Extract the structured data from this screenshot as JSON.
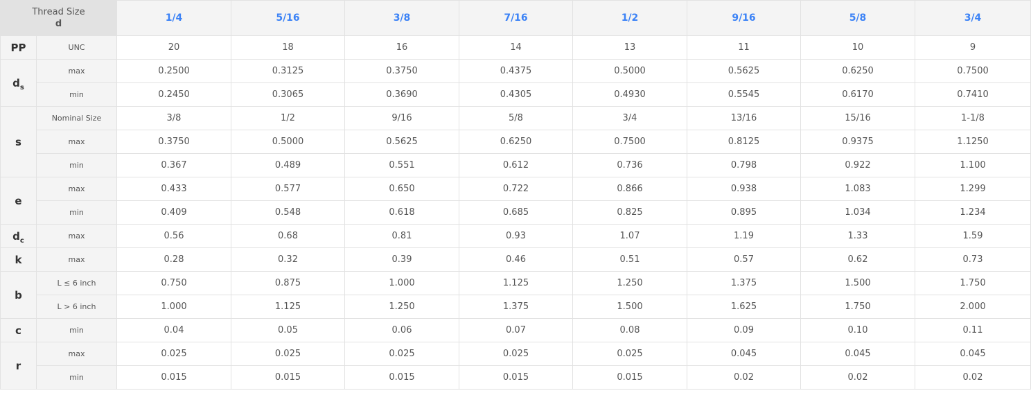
{
  "header": {
    "corner_title": "Thread Size",
    "corner_var": "d",
    "sizes": [
      "1/4",
      "5/16",
      "3/8",
      "7/16",
      "1/2",
      "9/16",
      "5/8",
      "3/4"
    ]
  },
  "params": {
    "pp": "PP",
    "ds": {
      "base": "d",
      "sub": "s"
    },
    "s": "s",
    "e": "e",
    "dc": {
      "base": "d",
      "sub": "c"
    },
    "k": "k",
    "b": "b",
    "c": "c",
    "r": "r"
  },
  "rows": [
    {
      "sub": "UNC",
      "values": [
        "20",
        "18",
        "16",
        "14",
        "13",
        "11",
        "10",
        "9"
      ]
    },
    {
      "sub": "max",
      "values": [
        "0.2500",
        "0.3125",
        "0.3750",
        "0.4375",
        "0.5000",
        "0.5625",
        "0.6250",
        "0.7500"
      ]
    },
    {
      "sub": "min",
      "values": [
        "0.2450",
        "0.3065",
        "0.3690",
        "0.4305",
        "0.4930",
        "0.5545",
        "0.6170",
        "0.7410"
      ]
    },
    {
      "sub": "Nominal Size",
      "values": [
        "3/8",
        "1/2",
        "9/16",
        "5/8",
        "3/4",
        "13/16",
        "15/16",
        "1-1/8"
      ]
    },
    {
      "sub": "max",
      "values": [
        "0.3750",
        "0.5000",
        "0.5625",
        "0.6250",
        "0.7500",
        "0.8125",
        "0.9375",
        "1.1250"
      ]
    },
    {
      "sub": "min",
      "values": [
        "0.367",
        "0.489",
        "0.551",
        "0.612",
        "0.736",
        "0.798",
        "0.922",
        "1.100"
      ]
    },
    {
      "sub": "max",
      "values": [
        "0.433",
        "0.577",
        "0.650",
        "0.722",
        "0.866",
        "0.938",
        "1.083",
        "1.299"
      ]
    },
    {
      "sub": "min",
      "values": [
        "0.409",
        "0.548",
        "0.618",
        "0.685",
        "0.825",
        "0.895",
        "1.034",
        "1.234"
      ]
    },
    {
      "sub": "max",
      "values": [
        "0.56",
        "0.68",
        "0.81",
        "0.93",
        "1.07",
        "1.19",
        "1.33",
        "1.59"
      ]
    },
    {
      "sub": "max",
      "values": [
        "0.28",
        "0.32",
        "0.39",
        "0.46",
        "0.51",
        "0.57",
        "0.62",
        "0.73"
      ]
    },
    {
      "sub": "L ≤ 6 inch",
      "values": [
        "0.750",
        "0.875",
        "1.000",
        "1.125",
        "1.250",
        "1.375",
        "1.500",
        "1.750"
      ]
    },
    {
      "sub": "L >  6 inch",
      "values": [
        "1.000",
        "1.125",
        "1.250",
        "1.375",
        "1.500",
        "1.625",
        "1.750",
        "2.000"
      ]
    },
    {
      "sub": "min",
      "values": [
        "0.04",
        "0.05",
        "0.06",
        "0.07",
        "0.08",
        "0.09",
        "0.10",
        "0.11"
      ]
    },
    {
      "sub": "max",
      "values": [
        "0.025",
        "0.025",
        "0.025",
        "0.025",
        "0.025",
        "0.045",
        "0.045",
        "0.045"
      ]
    },
    {
      "sub": "min",
      "values": [
        "0.015",
        "0.015",
        "0.015",
        "0.015",
        "0.015",
        "0.02",
        "0.02",
        "0.02"
      ]
    }
  ]
}
